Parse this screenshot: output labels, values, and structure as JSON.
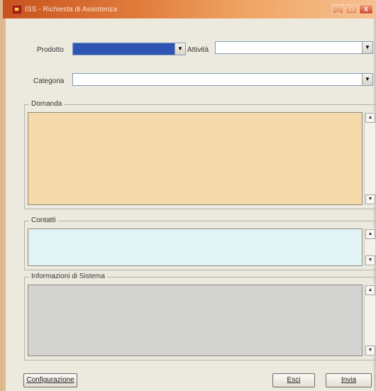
{
  "window": {
    "title": "ISS - Richiesta di Assistenza",
    "minimize_glyph": "_",
    "maximize_glyph": "□",
    "close_glyph": "X"
  },
  "form": {
    "prodotto_label": "Prodotto",
    "prodotto_value": "",
    "attivita_label": "Attività",
    "attivita_value": "",
    "categoria_label": "Categoria",
    "categoria_value": "",
    "dropdown_glyph": "▼"
  },
  "groups": {
    "domanda_label": "Domanda",
    "contatti_label": "Contatti",
    "info_label": "Informazioni di Sistema",
    "scroll_up_glyph": "▲",
    "scroll_down_glyph": "▼"
  },
  "buttons": {
    "configurazione": "Configurazione",
    "esci": "Esci",
    "invia": "Invia"
  },
  "colors": {
    "domanda_bg": "#f5d9aa",
    "contatti_bg": "#e2f3f6",
    "info_bg": "#d3d3d1",
    "selected_combo": "#2f55b4"
  }
}
